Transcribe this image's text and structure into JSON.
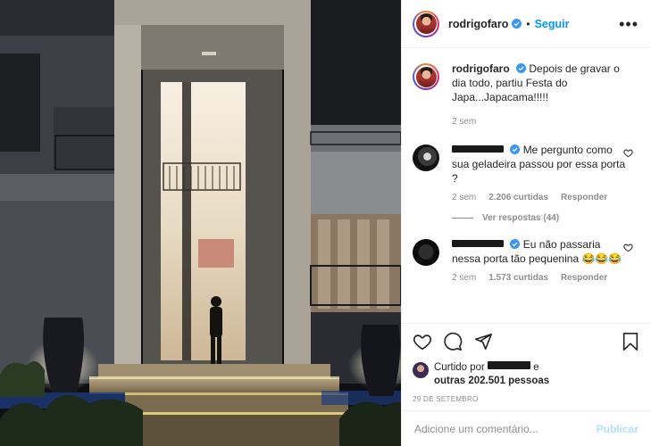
{
  "post": {
    "username": "rodrigofaro",
    "follow_label": "Seguir",
    "separator": "•",
    "more_label": "•••"
  },
  "caption": {
    "username": "rodrigofaro",
    "text": "Depois de gravar o dia todo, partiu Festa do Japa...Japacama!!!!!",
    "time": "2 sem"
  },
  "comments": [
    {
      "text": "Me pergunto como sua geladeira passou por essa porta ?",
      "time": "2 sem",
      "likes": "2.206 curtidas",
      "reply_label": "Responder",
      "view_replies": "Ver respostas (44)"
    },
    {
      "text": "Eu não passaria nessa porta tão pequenina 😂😂😂",
      "time": "2 sem",
      "likes": "1.573 curtidas",
      "reply_label": "Responder"
    }
  ],
  "likes": {
    "prefix": "Curtido por",
    "conj": "e",
    "others": "outras 202.501 pessoas"
  },
  "date": "29 DE SETEMBRO",
  "add_comment": {
    "placeholder": "Adicione um comentário...",
    "publish_label": "Publicar"
  },
  "colors": {
    "accent": "#0095f6",
    "publish_disabled": "#b2dffc",
    "verified": "#3897f0",
    "muted": "#8e8e8e"
  },
  "icons": [
    "heart-icon",
    "comment-icon",
    "share-icon",
    "bookmark-icon",
    "verified-icon",
    "more-icon"
  ]
}
